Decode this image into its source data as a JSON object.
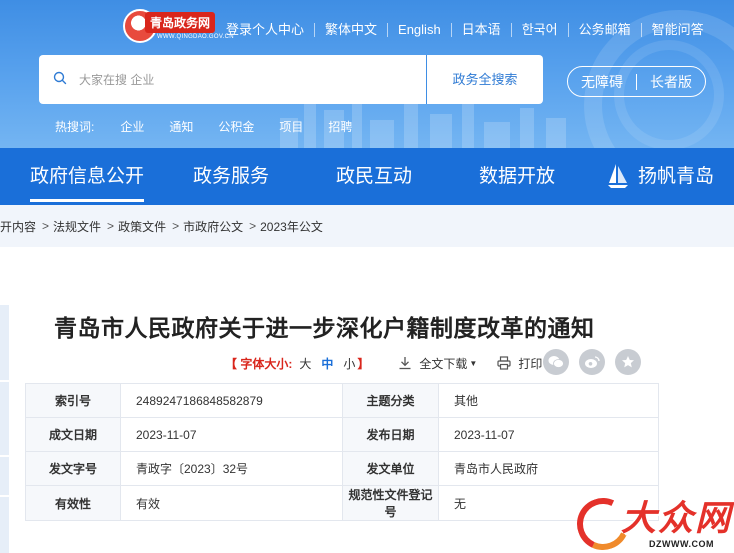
{
  "header": {
    "logo": {
      "title": "青岛政务网",
      "subtitle": "WWW.QINGDAO.GOV.CN"
    },
    "top_links": [
      "登录个人中心",
      "繁体中文",
      "English",
      "日本语",
      "한국어",
      "公务邮箱",
      "智能问答"
    ],
    "search": {
      "placeholder": "大家在搜 企业",
      "button": "政务全搜索"
    },
    "accessibility": {
      "barrier_free": "无障碍",
      "elder": "长者版"
    },
    "hot": {
      "label": "热搜词:",
      "items": [
        "企业",
        "通知",
        "公积金",
        "项目",
        "招聘"
      ]
    }
  },
  "nav": {
    "items": [
      "政府信息公开",
      "政务服务",
      "政民互动",
      "数据开放",
      "扬帆青岛"
    ],
    "active_index": 0
  },
  "breadcrumb": [
    "公开内容",
    "法规文件",
    "政策文件",
    "市政府公文",
    "2023年公文"
  ],
  "article": {
    "title": "青岛市人民政府关于进一步深化户籍制度改革的通知",
    "toolbar": {
      "font_label": "【 字体大小:",
      "sizes": [
        "大",
        "中",
        "小"
      ],
      "active_size": 1,
      "close_bracket": "】",
      "download": "全文下载",
      "print": "打印"
    },
    "share": [
      "wechat-icon",
      "weibo-icon",
      "favorite-icon"
    ],
    "meta": [
      {
        "k1": "索引号",
        "v1": "2489247186848582879",
        "k2": "主题分类",
        "v2": "其他"
      },
      {
        "k1": "成文日期",
        "v1": "2023-11-07",
        "k2": "发布日期",
        "v2": "2023-11-07"
      },
      {
        "k1": "发文字号",
        "v1": "青政字〔2023〕32号",
        "k2": "发文单位",
        "v2": "青岛市人民政府"
      },
      {
        "k1": "有效性",
        "v1": "有效",
        "k2": "规范性文件登记号",
        "v2": "无"
      }
    ]
  },
  "watermark": {
    "text": "大众网",
    "url": "DZWWW.COM"
  },
  "colors": {
    "header_blue": "#3f8ee4",
    "nav_blue": "#1a6fd9",
    "accent_red": "#d9261c"
  }
}
